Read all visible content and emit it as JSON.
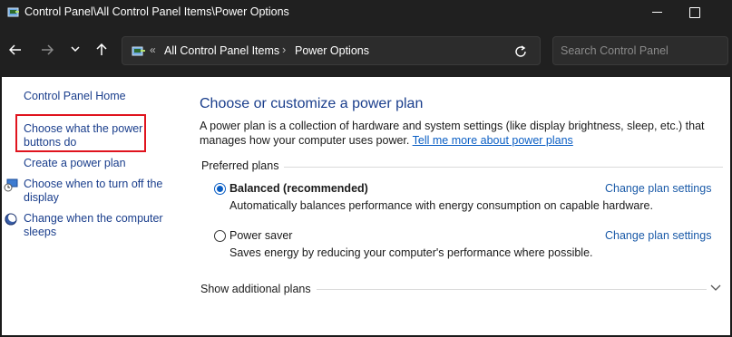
{
  "window": {
    "title": "Control Panel\\All Control Panel Items\\Power Options"
  },
  "navigation": {
    "breadcrumb_sep": "«",
    "crumbs": [
      "All Control Panel Items",
      "Power Options"
    ],
    "crumb_sep": "›"
  },
  "search": {
    "placeholder": "Search Control Panel"
  },
  "sidebar": {
    "home": "Control Panel Home",
    "items": [
      "Choose what the power buttons do",
      "Create a power plan",
      "Choose when to turn off the display",
      "Change when the computer sleeps"
    ]
  },
  "main": {
    "title": "Choose or customize a power plan",
    "description": "A power plan is a collection of hardware and system settings (like display brightness, sleep, etc.) that manages how your computer uses power.",
    "learn_more_link": "Tell me more about power plans",
    "preferred_label": "Preferred plans",
    "plans": [
      {
        "name": "Balanced (recommended)",
        "description": "Automatically balances performance with energy consumption on capable hardware.",
        "link": "Change plan settings",
        "selected": true
      },
      {
        "name": "Power saver",
        "description": "Saves energy by reducing your computer's performance where possible.",
        "link": "Change plan settings",
        "selected": false
      }
    ],
    "show_additional": "Show additional plans"
  },
  "icons": {
    "title": "power-options-icon",
    "back": "arrow-left-icon",
    "forward": "arrow-right-icon",
    "recent": "chevron-down-icon",
    "up": "arrow-up-icon",
    "address": "control-panel-icon",
    "refresh": "refresh-icon",
    "display": "display-timer-icon",
    "sleep": "moon-sleep-icon",
    "expand": "chevron-down-icon"
  },
  "colors": {
    "link": "#1a3e8c",
    "accent": "#0a5ec4",
    "highlight": "#e0141e",
    "titlebar": "#202020"
  }
}
